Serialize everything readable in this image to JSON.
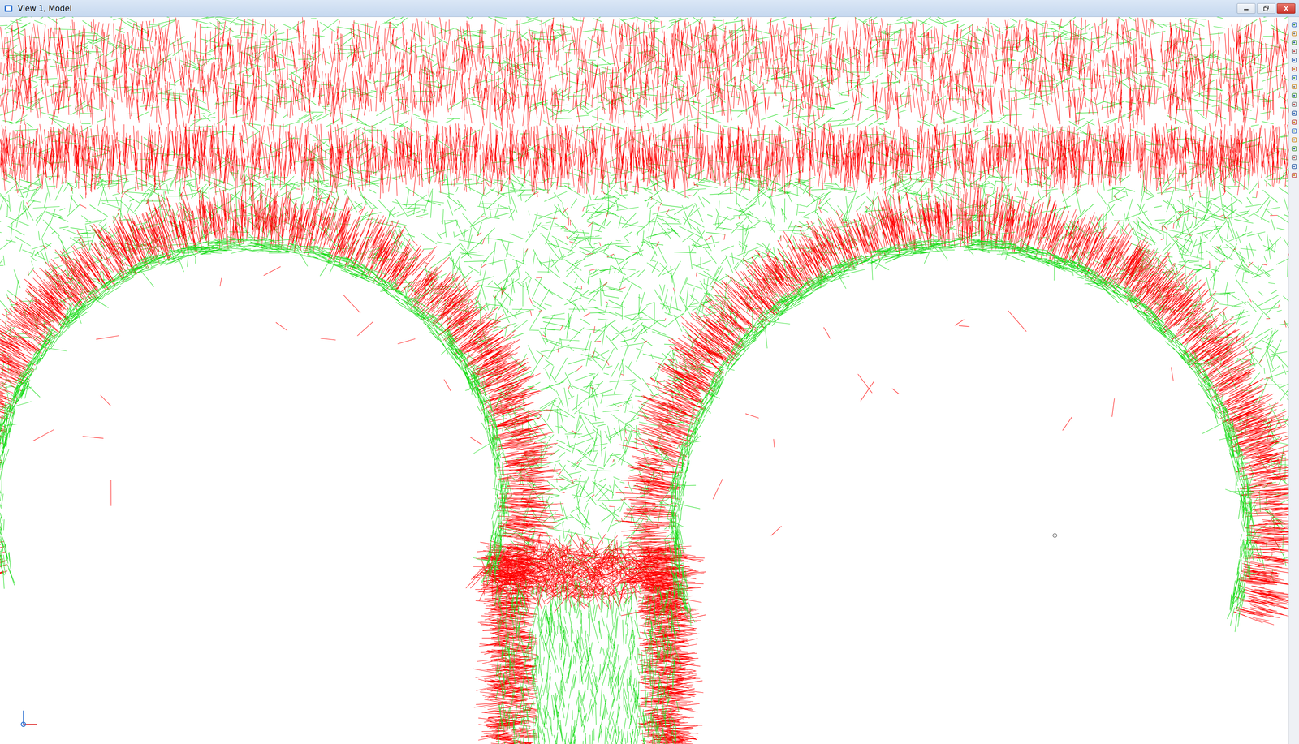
{
  "window": {
    "title": "View 1, Model"
  }
}
